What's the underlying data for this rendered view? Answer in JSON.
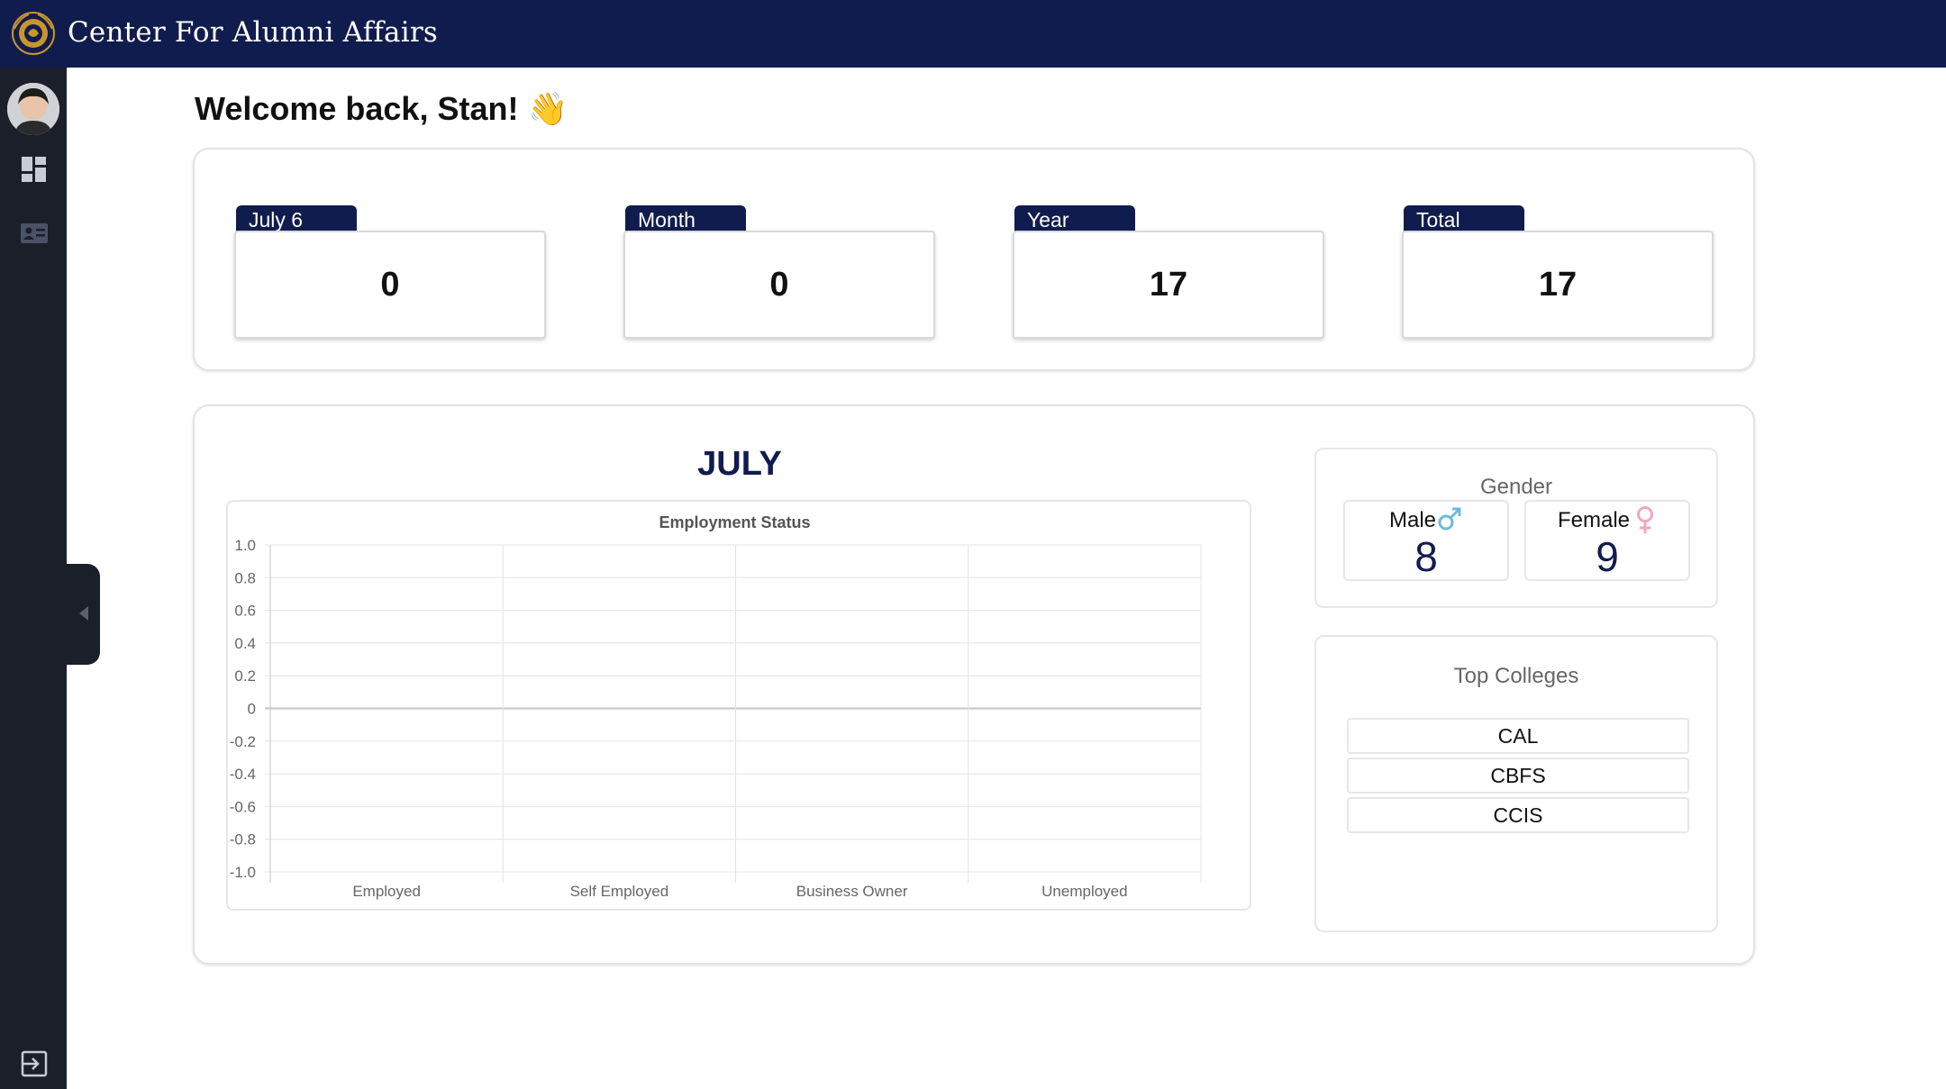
{
  "header": {
    "title": "Center For Alumni Affairs"
  },
  "sidebar": {
    "items": [
      {
        "name": "dashboard",
        "icon": "dashboard-icon"
      },
      {
        "name": "alumni-cards",
        "icon": "id-card-icon"
      }
    ],
    "logout_icon": "logout-icon"
  },
  "welcome": {
    "text": "Welcome back, Stan! 👋"
  },
  "stats": [
    {
      "label": "July 6",
      "value": "0"
    },
    {
      "label": "Month",
      "value": "0"
    },
    {
      "label": "Year",
      "value": "17"
    },
    {
      "label": "Total",
      "value": "17"
    }
  ],
  "month_title": "JULY",
  "gender": {
    "title": "Gender",
    "male_label": "Male",
    "male_value": "8",
    "female_label": "Female",
    "female_value": "9"
  },
  "colleges": {
    "title": "Top Colleges",
    "items": [
      "CAL",
      "CBFS",
      "CCIS"
    ]
  },
  "chart_data": {
    "type": "bar",
    "title": "Employment Status",
    "categories": [
      "Employed",
      "Self Employed",
      "Business Owner",
      "Unemployed"
    ],
    "values": [
      0,
      0,
      0,
      0
    ],
    "yticks": [
      "1.0",
      "0.8",
      "0.6",
      "0.4",
      "0.2",
      "0",
      "-0.2",
      "-0.4",
      "-0.6",
      "-0.8",
      "-1.0"
    ],
    "ylim": [
      -1,
      1
    ],
    "grid": true
  },
  "colors": {
    "navy": "#111c4e",
    "sidebar": "#1b1f2a",
    "male": "#6fb8e0",
    "female": "#f2a7bd"
  }
}
